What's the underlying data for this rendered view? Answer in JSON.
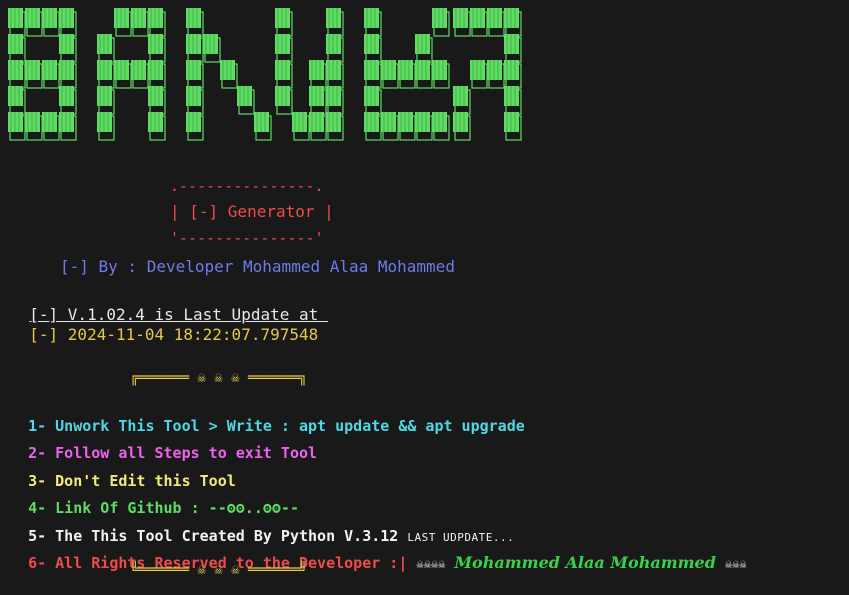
{
  "banner": {
    "rows": [
      "▀▀▀▀▀▌ ▐▀▀▀▌▐▀▌   ▐▀▌▐▀▀▌ ▐▀▌▀▀▀▀▀▀▀▀▀▀▀▀▀▌",
      "▐▀▌▀▀▌▐▀▌▀▀▌▐▀▀▀▌ ▐▀▌▐▀▌▐▀▌▐▀▌▀▀▀▀▀▌▐▀▌▀▀▌",
      "▀▀▀▀▀▌▀▀▀▀▀▌▐▀▌▀▌▐▀▌▐▀▌▐▀▌▐▀▀▀▀▀▌ ▐▀▀▀▀▀▌",
      "▐▀▌▀▀▌▐▀▌▀▀▌▐▀▌▐▀▀▀▌ ▐▀▀▀▌▐▀▌▀▀▀▀ ▐▀▌▀▀▌",
      "▀▀▀▀▀▌▐▀▌ ▐▀▌▐▀▌ ▀▀▌ ▀▀▀▀▀▀▀▀▀▀▀▌▐▀▌▐▀▌"
    ],
    "color": "#5fdc63",
    "shadow": "#5fdc63"
  },
  "generator_box": {
    "top": ".---------------.",
    "middle": "| [-] Generator |",
    "bottom": "'---------------'"
  },
  "by_line": "[-] By : Developer Mohammed Alaa Mohammed",
  "update": {
    "left": "[-] V.1.02.4 is Last Update at ",
    "stamp": "[-] 2024-11-04 18:22:07.797548"
  },
  "frame": {
    "top": "╔══════ ☠ ☠ ☠ ══════╗",
    "bottom": "╚══════ ☠ ☠ ☠ ══════╝"
  },
  "steps": [
    {
      "num": "1-",
      "text": "Unwork This Tool > Write : apt update && apt upgrade"
    },
    {
      "num": "2-",
      "text": "Follow all Steps to exit Tool"
    },
    {
      "num": "3-",
      "text": "Don't Edit this Tool"
    },
    {
      "num": "4-",
      "text": "Link Of Github : --ʘʘ..ʘʘ--"
    },
    {
      "num": "5-",
      "text": "The This Tool Created By Python V.3.12",
      "small": "LAST UDPDATE..."
    },
    {
      "num": "6-",
      "text": "All Rights Reserved to the Developer :|",
      "deco": "☠☠☠☠",
      "author": "Mohammed Alaa Mohammed",
      "deco2": "☠☠☠"
    }
  ]
}
